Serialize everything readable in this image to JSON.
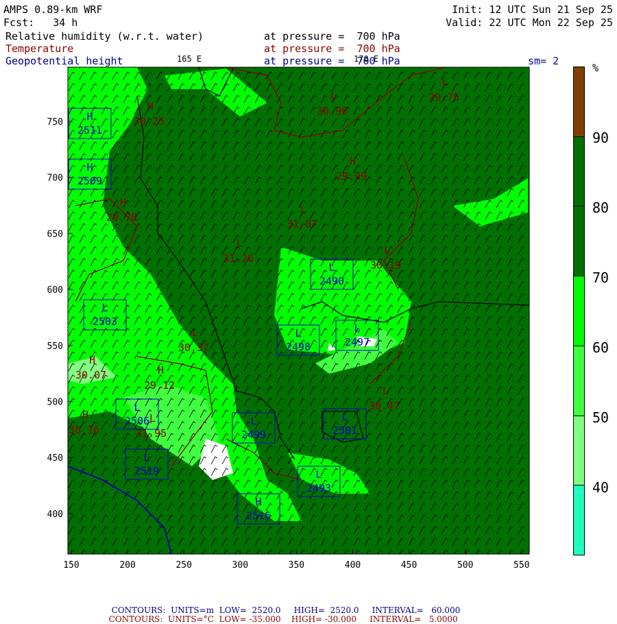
{
  "header": {
    "model": "AMPS 0.89-km WRF",
    "forecast": "Fcst:   34 h",
    "init": "Init: 12 UTC Sun 21 Sep 25",
    "valid": "Valid: 22 UTC Mon 22 Sep 25",
    "field1": "Relative humidity (w.r.t. water)",
    "field1_level": "at pressure =  700 hPa",
    "field2": "Temperature",
    "field2_level": "at pressure =  700 hPa",
    "field3": "Geopotential height",
    "field3_level": "at pressure =  700 hPa",
    "lon1": "165 E",
    "lon2": "170 E",
    "smoothing": "sm= 2"
  },
  "colorbar": {
    "unit": "%",
    "labels": [
      "90",
      "80",
      "70",
      "60",
      "50",
      "40"
    ],
    "colors": [
      "#7f3f00",
      "#007000",
      "#007000",
      "#00ff00",
      "#40ff40",
      "#80ff80",
      "#20ffc0"
    ]
  },
  "axes": {
    "x_ticks": [
      "150",
      "200",
      "250",
      "300",
      "350",
      "400",
      "450",
      "500",
      "550"
    ],
    "y_ticks": [
      "750",
      "700",
      "650",
      "600",
      "550",
      "500",
      "450",
      "400"
    ]
  },
  "map": {
    "height_labels": [
      {
        "type": "H",
        "value": "2511"
      },
      {
        "type": "H",
        "value": "2509"
      },
      {
        "type": "L",
        "value": "2503"
      },
      {
        "type": "L",
        "value": "2490"
      },
      {
        "type": "L",
        "value": "2498"
      },
      {
        "type": "L",
        "value": "2497"
      },
      {
        "type": "L",
        "value": "2506"
      },
      {
        "type": "L",
        "value": "2519"
      },
      {
        "type": "L",
        "value": "2501"
      },
      {
        "type": "L",
        "value": "2493"
      },
      {
        "type": "L",
        "value": "2499"
      },
      {
        "type": "H",
        "value": "2516"
      }
    ],
    "temp_labels": [
      {
        "type": "H",
        "value": "30.25"
      },
      {
        "type": "L",
        "value": "29.75"
      },
      {
        "type": "H",
        "value": "29.99"
      },
      {
        "type": "H",
        "value": "29.78"
      },
      {
        "type": "L",
        "value": "31.26"
      },
      {
        "type": "L",
        "value": "30.19"
      },
      {
        "type": "L",
        "value": "30.57"
      },
      {
        "type": "H",
        "value": "29.12"
      },
      {
        "type": "H",
        "value": "30.07"
      },
      {
        "type": "L",
        "value": "30.47"
      },
      {
        "type": "H",
        "value": "30.16"
      },
      {
        "type": "L",
        "value": "31.95"
      },
      {
        "type": "L",
        "value": "30.90"
      },
      {
        "type": "L",
        "value": "31.07"
      }
    ]
  },
  "footer": {
    "line1": {
      "label": "CONTOURS:",
      "units": "UNITS=m",
      "low": "LOW=  2520.0",
      "high": "HIGH=  2520.0",
      "interval": "INTERVAL=   60.000"
    },
    "line2": {
      "label": "CONTOURS:",
      "units": "UNITS=°C",
      "low": "LOW= -35.000",
      "high": "HIGH= -30.000",
      "interval": "INTERVAL=   5.0000"
    }
  }
}
